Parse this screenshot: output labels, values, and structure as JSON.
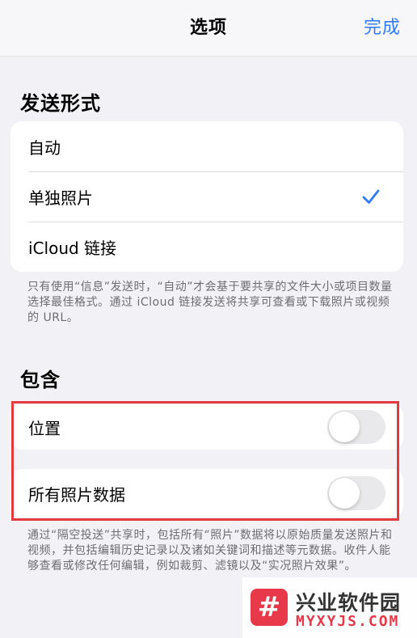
{
  "nav": {
    "title": "选项",
    "done_label": "完成"
  },
  "send_format": {
    "header": "发送形式",
    "options": [
      {
        "label": "自动",
        "selected": false
      },
      {
        "label": "单独照片",
        "selected": true
      },
      {
        "label": "iCloud 链接",
        "selected": false
      }
    ],
    "footer": "只有使用“信息”发送时，“自动”才会基于要共享的文件大小或项目数量选择最佳格式。通过 iCloud 链接发送将共享可查看或下载照片或视频的 URL。"
  },
  "include": {
    "header": "包含",
    "location": {
      "label": "位置",
      "on": false
    },
    "all_photos_data": {
      "label": "所有照片数据",
      "on": false
    },
    "footer": "通过“隔空投送”共享时，包括所有“照片”数据将以原始质量发送照片和视频，并包括编辑历史记录以及诸如关键词和描述等元数据。收件人能够查看或修改任何编辑，例如裁剪、滤镜以及“实况照片效果”。"
  },
  "watermark": {
    "logo_glyph": "#",
    "name": "兴业软件园",
    "url": "MYXYJS.COM"
  },
  "colors": {
    "accent": "#2f7cf6",
    "highlight": "#e23a3f",
    "background": "#f2f2f6",
    "toggle_off": "#e9e9eb"
  },
  "icons": {
    "selected_check": "checkmark-icon"
  }
}
